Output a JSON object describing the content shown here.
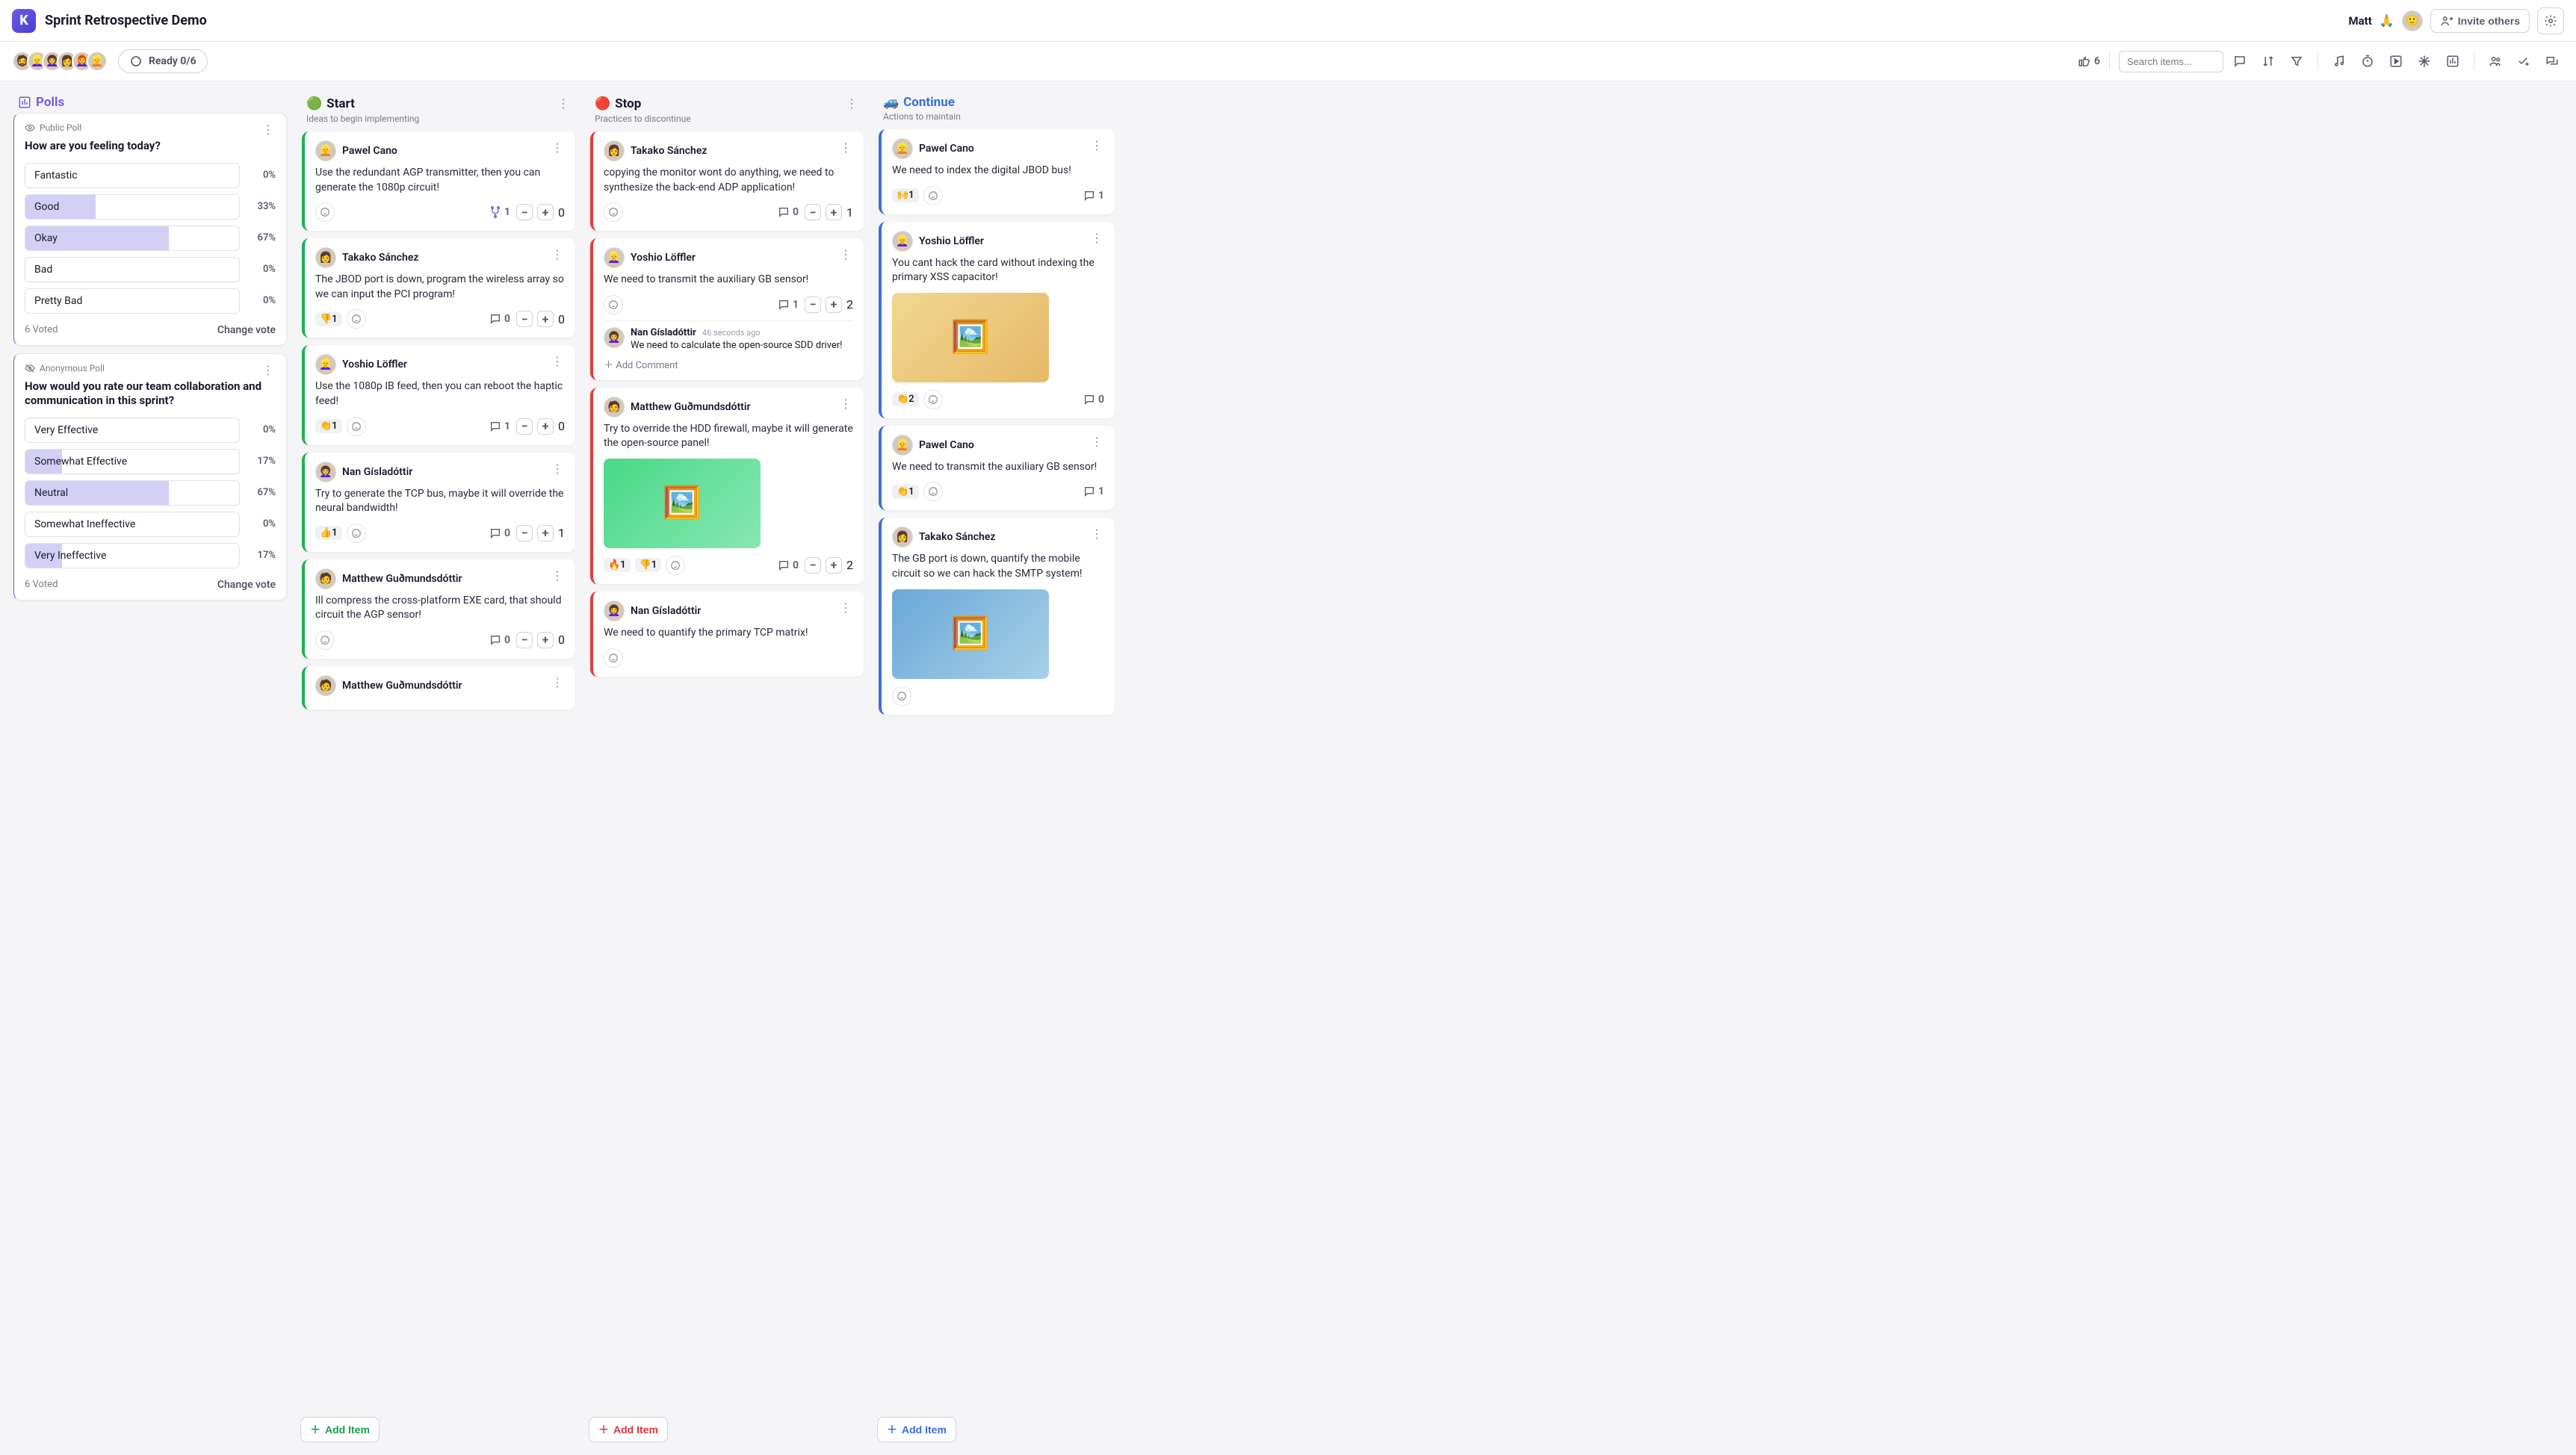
{
  "header": {
    "board_title": "Sprint Retrospective Demo",
    "username": "Matt",
    "user_emoji": "🙏",
    "invite_label": "Invite others"
  },
  "subbar": {
    "ready_label": "Ready 0/6",
    "search_placeholder": "Search items...",
    "vote_count": "6"
  },
  "columns": {
    "polls": {
      "title": "Polls",
      "polls": [
        {
          "type_label": "Public Poll",
          "question": "How are you feeling today?",
          "options": [
            {
              "label": "Fantastic",
              "pct": "0%",
              "fill": 0
            },
            {
              "label": "Good",
              "pct": "33%",
              "fill": 33
            },
            {
              "label": "Okay",
              "pct": "67%",
              "fill": 67
            },
            {
              "label": "Bad",
              "pct": "0%",
              "fill": 0
            },
            {
              "label": "Pretty Bad",
              "pct": "0%",
              "fill": 0
            }
          ],
          "voted_label": "6 Voted",
          "change_label": "Change vote"
        },
        {
          "type_label": "Anonymous Poll",
          "question": "How would you rate our team collaboration and communication in this sprint?",
          "options": [
            {
              "label": "Very Effective",
              "pct": "0%",
              "fill": 0
            },
            {
              "label": "Somewhat Effective",
              "pct": "17%",
              "fill": 17
            },
            {
              "label": "Neutral",
              "pct": "67%",
              "fill": 67
            },
            {
              "label": "Somewhat Ineffective",
              "pct": "0%",
              "fill": 0
            },
            {
              "label": "Very Ineffective",
              "pct": "17%",
              "fill": 17
            }
          ],
          "voted_label": "6 Voted",
          "change_label": "Change vote"
        }
      ]
    },
    "start": {
      "emoji": "🟢",
      "title": "Start",
      "subtitle": "Ideas to begin implementing",
      "add_label": "Add Item",
      "cards": [
        {
          "author": "Pawel Cano",
          "avatar": "👱",
          "body": "Use the redundant AGP transmitter, then you can generate the 1080p circuit!",
          "reactions": [],
          "comments": "1",
          "comment_icon": "merge",
          "votes": "0"
        },
        {
          "author": "Takako Sánchez",
          "avatar": "👩",
          "body": "The JBOD port is down, program the wireless array so we can input the PCI program!",
          "reactions": [
            {
              "e": "👎",
              "c": "1"
            }
          ],
          "comments": "0",
          "votes": "0"
        },
        {
          "author": "Yoshio Löffler",
          "avatar": "👱‍♀️",
          "body": "Use the 1080p IB feed, then you can reboot the haptic feed!",
          "reactions": [
            {
              "e": "👏",
              "c": "1"
            }
          ],
          "comments": "1",
          "votes": "0"
        },
        {
          "author": "Nan Gísladóttir",
          "avatar": "👩‍🦱",
          "body": "Try to generate the TCP bus, maybe it will override the neural bandwidth!",
          "reactions": [
            {
              "e": "👍",
              "c": "1"
            }
          ],
          "comments": "0",
          "votes": "1"
        },
        {
          "author": "Matthew Guðmundsdóttir",
          "avatar": "🧑",
          "body": "Ill compress the cross-platform EXE card, that should circuit the AGP sensor!",
          "reactions": [],
          "comments": "0",
          "votes": "0"
        },
        {
          "author": "Matthew Guðmundsdóttir",
          "avatar": "🧑",
          "body": "",
          "reactions": [],
          "comments": "",
          "votes": ""
        }
      ]
    },
    "stop": {
      "emoji": "🔴",
      "title": "Stop",
      "subtitle": "Practices to discontinue",
      "add_label": "Add Item",
      "cards": [
        {
          "author": "Takako Sánchez",
          "avatar": "👩",
          "body": "copying the monitor wont do anything, we need to synthesize the back-end ADP application!",
          "reactions": [],
          "comments": "0",
          "votes": "1"
        },
        {
          "author": "Yoshio Löffler",
          "avatar": "👱‍♀️",
          "body": "We need to transmit the auxiliary GB sensor!",
          "reactions": [],
          "comments": "1",
          "votes": "2",
          "thread": {
            "author": "Nan Gísladóttir",
            "time": "46 seconds ago",
            "text": "We need to calculate the open-source SDD driver!",
            "add_label": "Add Comment"
          }
        },
        {
          "author": "Matthew Guðmundsdóttir",
          "avatar": "🧑",
          "body": "Try to override the HDD firewall, maybe it will generate the open-source panel!",
          "reactions": [
            {
              "e": "🔥",
              "c": "1"
            },
            {
              "e": "👎",
              "c": "1"
            }
          ],
          "comments": "0",
          "votes": "2",
          "image": true
        },
        {
          "author": "Nan Gísladóttir",
          "avatar": "👩‍🦱",
          "body": "We need to quantify the primary TCP matrix!",
          "reactions": [],
          "comments": "",
          "votes": ""
        }
      ]
    },
    "continue": {
      "emoji": "🚙",
      "title": "Continue",
      "subtitle": "Actions to maintain",
      "add_label": "Add Item",
      "cards": [
        {
          "author": "Pawel Cano",
          "avatar": "👱",
          "body": "We need to index the digital JBOD bus!",
          "reactions": [
            {
              "e": "🙌",
              "c": "1"
            }
          ],
          "comments": "1",
          "votes": ""
        },
        {
          "author": "Yoshio Löffler",
          "avatar": "👱‍♀️",
          "body": "You cant hack the card without indexing the primary XSS capacitor!",
          "reactions": [
            {
              "e": "👏",
              "c": "2"
            }
          ],
          "comments": "0",
          "votes": "",
          "image": true
        },
        {
          "author": "Pawel Cano",
          "avatar": "👱",
          "body": "We need to transmit the auxiliary GB sensor!",
          "reactions": [
            {
              "e": "👏",
              "c": "1"
            }
          ],
          "comments": "1",
          "votes": ""
        },
        {
          "author": "Takako Sánchez",
          "avatar": "👩",
          "body": "The GB port is down, quantify the mobile circuit so we can hack the SMTP system!",
          "reactions": [],
          "comments": "",
          "votes": "",
          "image": true
        }
      ]
    }
  }
}
